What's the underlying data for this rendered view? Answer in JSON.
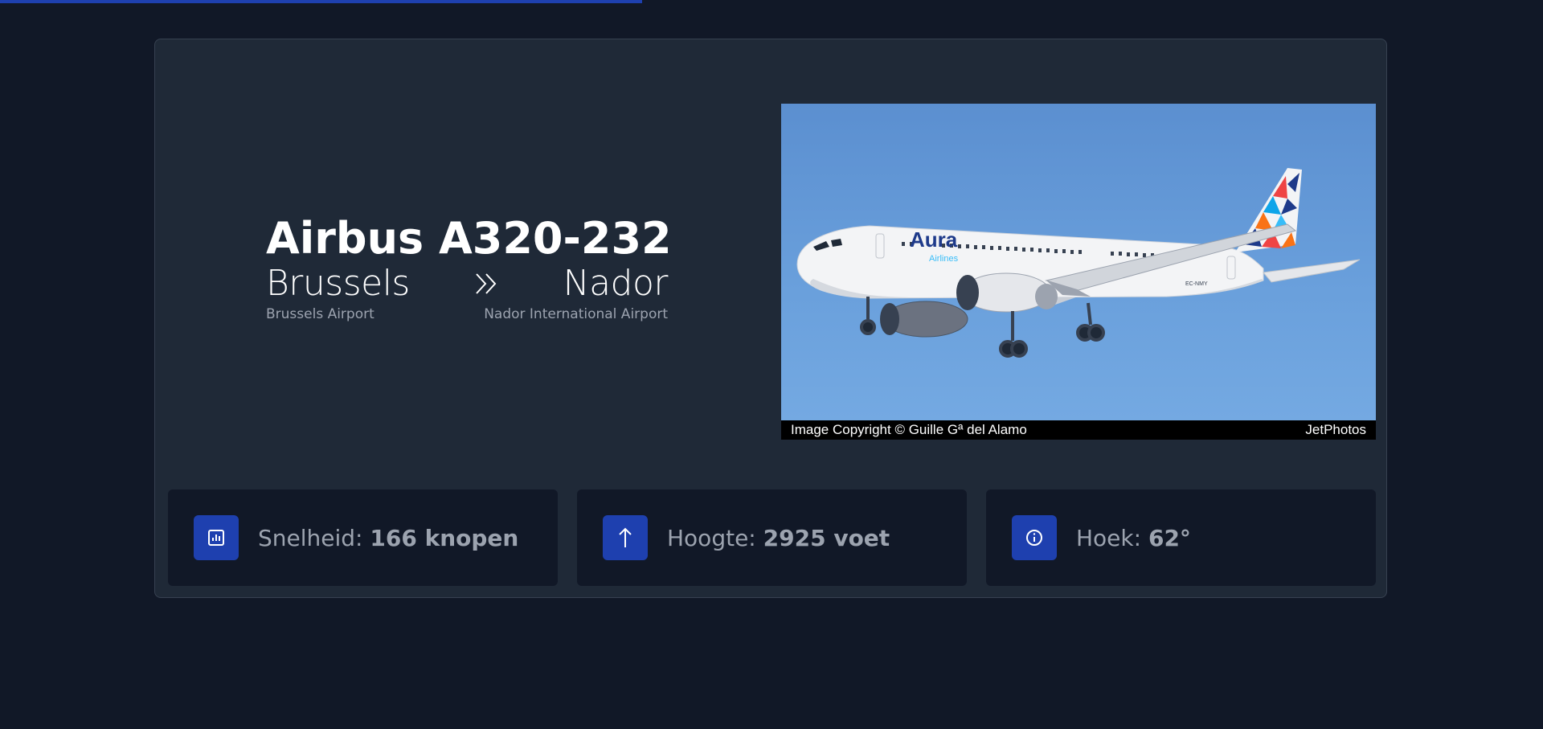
{
  "progress": {
    "fraction": 0.416,
    "color": "#1e40af"
  },
  "flight": {
    "aircraft": "Airbus A320-232",
    "origin_city": "Brussels",
    "destination_city": "Nador",
    "origin_airport": "Brussels Airport",
    "destination_airport": "Nador International Airport",
    "route_icon": "chevron-double-right-icon"
  },
  "photo": {
    "copyright": "Image Copyright © Guille Gª del Alamo",
    "source": "JetPhotos",
    "livery_text": "Aura",
    "livery_subtext": "Airlines",
    "registration": "EC-NMY"
  },
  "stats": [
    {
      "label": "Snelheid:",
      "value": "166 knopen",
      "icon": "bar-chart-icon"
    },
    {
      "label": "Hoogte:",
      "value": "2925 voet",
      "icon": "arrow-up-icon"
    },
    {
      "label": "Hoek:",
      "value": "62°",
      "icon": "info-icon"
    }
  ],
  "colors": {
    "background": "#111827",
    "card": "#1f2937",
    "accent": "#1e40af",
    "muted_text": "#9ca3af"
  }
}
